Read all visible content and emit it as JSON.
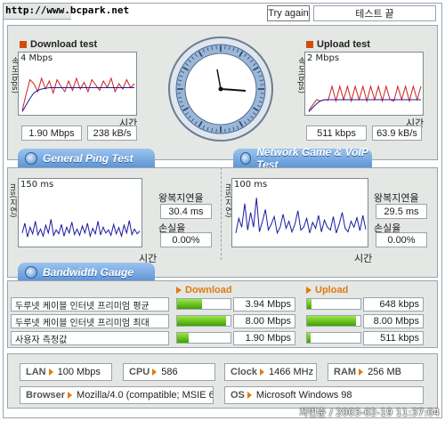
{
  "header": {
    "site": "http://www.bcpark.net",
    "try_again_label": "Try again",
    "test_result_label": "테스트 끝"
  },
  "download": {
    "title": "Download test",
    "y_label": "속도(bps)",
    "scale_label": "4 Mbps",
    "time_label": "시간",
    "speed_mbps": "1.90 Mbps",
    "speed_kBs": "238 kB/s",
    "scale_max": 4,
    "avg_series": [
      0.1,
      0.6,
      1.1,
      1.5,
      1.7,
      1.8,
      1.85,
      1.9,
      1.9,
      1.9,
      1.9,
      1.9,
      1.9,
      1.9,
      1.9,
      1.9,
      1.9,
      1.9,
      1.9,
      1.9,
      1.9,
      1.9,
      1.9,
      1.9,
      1.9,
      1.9,
      1.9,
      1.9,
      1.9,
      1.9
    ],
    "inst_series": [
      0.2,
      1.4,
      2.5,
      2.2,
      1.6,
      2.6,
      1.8,
      2.4,
      1.5,
      2.5,
      2.0,
      1.6,
      2.4,
      1.7,
      2.6,
      1.8,
      2.3,
      1.6,
      2.5,
      2.1,
      1.7,
      2.4,
      1.9,
      2.6,
      1.6,
      2.2,
      1.8,
      2.5,
      1.9,
      2.2
    ]
  },
  "upload": {
    "title": "Upload test",
    "y_label": "속도(bps)",
    "scale_label": "2 Mbps",
    "time_label": "시간",
    "speed_kbps": "511 kbps",
    "speed_kBs": "63.9 kB/s",
    "scale_max": 2,
    "avg_series": [
      0.05,
      0.2,
      0.35,
      0.45,
      0.5,
      0.5,
      0.5,
      0.5,
      0.5,
      0.5,
      0.5,
      0.5,
      0.5,
      0.5,
      0.5,
      0.5,
      0.5,
      0.5,
      0.5,
      0.5,
      0.5,
      0.5,
      0.5,
      0.5,
      0.5,
      0.5,
      0.5,
      0.5,
      0.5,
      0.5
    ],
    "inst_series": [
      0.1,
      0.3,
      0.5,
      0.45,
      0.5,
      0.48,
      1.0,
      0.45,
      1.0,
      0.5,
      1.0,
      0.45,
      1.0,
      0.5,
      1.0,
      0.45,
      1.0,
      0.5,
      1.0,
      0.45,
      1.0,
      0.5,
      0.45,
      1.0,
      0.5,
      1.0,
      0.45,
      1.0,
      0.5,
      1.0
    ]
  },
  "ping": {
    "tab_label": "General Ping Test",
    "y_label": "ms(지연)",
    "scale_label": "150 ms",
    "time_label": "시간",
    "rtt_label": "왕복지연율",
    "rtt_value": "30.4 ms",
    "loss_label": "손실율",
    "loss_value": "0.00%",
    "scale_max": 150,
    "series": [
      30,
      55,
      20,
      45,
      28,
      60,
      25,
      40,
      22,
      50,
      30,
      65,
      24,
      38,
      28,
      52,
      22,
      45,
      30,
      58,
      26,
      40,
      24,
      48,
      30,
      55,
      22,
      42,
      28,
      60,
      25,
      45,
      30,
      38,
      24,
      52,
      28,
      44,
      22,
      50,
      30,
      62,
      26,
      40,
      28,
      35
    ]
  },
  "game": {
    "tab_label": "Network Game & VoIP Test",
    "y_label": "ms(지연)",
    "scale_label": "100 ms",
    "time_label": "시간",
    "rtt_label": "왕복지연율",
    "rtt_value": "29.5 ms",
    "loss_label": "손실율",
    "loss_value": "0.00%",
    "scale_max": 100,
    "series": [
      20,
      45,
      30,
      70,
      25,
      55,
      30,
      80,
      22,
      40,
      60,
      25,
      35,
      48,
      20,
      30,
      52,
      28,
      40,
      22,
      35,
      58,
      25,
      30,
      45,
      20,
      38,
      28,
      50,
      22,
      42,
      30,
      25,
      48,
      20,
      35,
      55,
      28,
      22,
      40,
      30,
      46,
      24,
      50,
      26
    ]
  },
  "gauge": {
    "tab_label": "Bandwidth Gauge",
    "download_label": "Download",
    "upload_label": "Upload",
    "rows": [
      {
        "name": "두루넷 케이블 인터넷 프리미엄 평균",
        "down": "3.94 Mbps",
        "down_frac": 0.46,
        "up": "648 kbps",
        "up_frac": 0.08
      },
      {
        "name": "두루넷 케이블 인터넷 프리미엄 최대",
        "down": "8.00 Mbps",
        "down_frac": 0.92,
        "up": "8.00 Mbps",
        "up_frac": 0.92
      },
      {
        "name": "사용자 측정값",
        "down": "1.90 Mbps",
        "down_frac": 0.22,
        "up": "511 kbps",
        "up_frac": 0.06
      }
    ]
  },
  "system": {
    "lan_label": "LAN",
    "lan_value": "100 Mbps",
    "cpu_label": "CPU",
    "cpu_value": "586",
    "clock_label": "Clock",
    "clock_value": "1466 MHz",
    "ram_label": "RAM",
    "ram_value": "256 MB",
    "browser_label": "Browser",
    "browser_value": "Mozilla/4.0 (compatible; MSIE 6.0",
    "os_label": "OS",
    "os_value": "Microsoft Windows 98"
  },
  "footer": {
    "watermark": "차민준 / 2003-02-19 11:37:04"
  },
  "colors": {
    "panel_bg": "#e4e7e4",
    "avg_line": "#1a1aa0",
    "inst_line": "#cc2020",
    "ping_line": "#1a1aa0",
    "tab_blue": "#5e95d6",
    "gauge_green": "#3ea200"
  }
}
